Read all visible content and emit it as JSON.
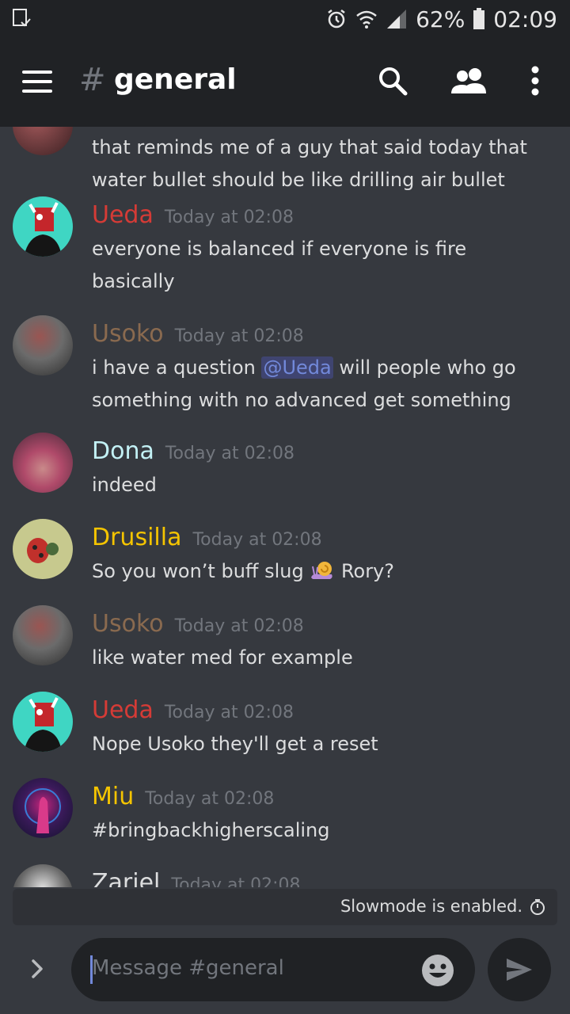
{
  "status_bar": {
    "battery": "62%",
    "time": "02:09",
    "icons": [
      "download-icon",
      "alarm-icon",
      "wifi-icon",
      "signal-icon",
      "battery-icon"
    ]
  },
  "app_bar": {
    "hash": "#",
    "channel": "general",
    "icons": [
      "menu-icon",
      "search-icon",
      "members-icon",
      "more-icon"
    ]
  },
  "messages": [
    {
      "author": "",
      "timestamp": "",
      "lines": [
        "that reminds me of a guy that said today that",
        "water bullet should be like drilling air bullet"
      ]
    },
    {
      "author": "Ueda",
      "color": "#d53b36",
      "timestamp": "Today at 02:08",
      "lines": [
        "everyone is balanced if everyone is fire",
        "basically"
      ]
    },
    {
      "author": "Usoko",
      "color": "#8a6a4f",
      "timestamp": "Today at 02:08",
      "line1_before": "i have a question ",
      "mention": "@Ueda",
      "line1_after": " will people who go",
      "line2": "something with no advanced get something"
    },
    {
      "author": "Dona",
      "color": "#c3f1f5",
      "timestamp": "Today at 02:08",
      "lines": [
        "indeed"
      ]
    },
    {
      "author": "Drusilla",
      "color": "#f4c400",
      "timestamp": "Today at 02:08",
      "text_before": "So you won’t buff slug ",
      "emoji": "snail-icon",
      "text_after": " Rory?"
    },
    {
      "author": "Usoko",
      "color": "#8a6a4f",
      "timestamp": "Today at 02:08",
      "lines": [
        "like water med for example"
      ]
    },
    {
      "author": "Ueda",
      "color": "#d53b36",
      "timestamp": "Today at 02:08",
      "lines": [
        "Nope Usoko they'll get a reset"
      ]
    },
    {
      "author": "Miu",
      "color": "#f4c400",
      "timestamp": "Today at 02:08",
      "lines": [
        "#bringbackhigherscaling"
      ]
    },
    {
      "author": "Zariel",
      "color": "#dcddde",
      "timestamp": "Today at 02:08",
      "lines": []
    }
  ],
  "slowmode": {
    "text": "Slowmode is enabled.",
    "icon": "stopwatch-icon"
  },
  "composer": {
    "placeholder": "Message #general",
    "icons": [
      "expand-icon",
      "emoji-icon",
      "send-icon"
    ]
  },
  "colors": {
    "background": "#36393f",
    "bars": "#202225",
    "mention": "#7289da"
  }
}
